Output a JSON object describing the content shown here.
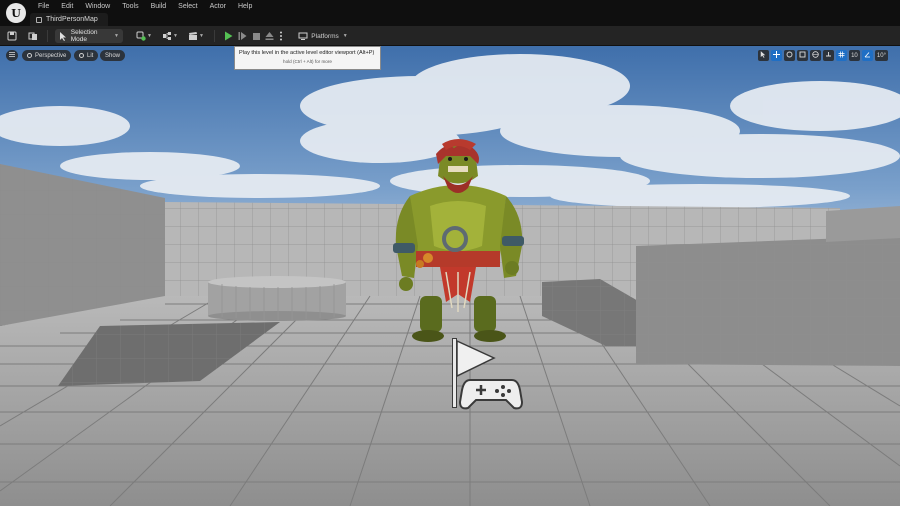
{
  "app": {
    "logo_glyph": "U"
  },
  "menu": [
    "File",
    "Edit",
    "Window",
    "Tools",
    "Build",
    "Select",
    "Actor",
    "Help"
  ],
  "tab": {
    "label": "ThirdPersonMap"
  },
  "toolbar": {
    "selection_mode_label": "Selection Mode",
    "platforms_label": "Platforms"
  },
  "viewport": {
    "perspective_label": "Perspective",
    "lit_label": "Lit",
    "show_label": "Show",
    "grid_snap_value": "10",
    "rotation_snap_value": "10°"
  },
  "tooltip": {
    "text": "Play this level in the active level editor viewport (Alt+P)",
    "hint": "hold (Ctrl + Alt) for more"
  },
  "colors": {
    "sky_top": "#4f7fb8",
    "sky_bottom": "#c3d3e4",
    "floor": "#9e9e9e",
    "wall": "#b7b7b7",
    "accent_blue": "#1f6fc5",
    "play_green": "#54c053"
  },
  "icons": {
    "save": "save-icon",
    "content_browser": "content-browser-icon",
    "add_actor": "add-actor-icon",
    "blueprints": "blueprint-icon",
    "cinematics": "clapper-icon",
    "play": "play-icon",
    "skip": "step-icon",
    "stop": "stop-icon",
    "eject": "eject-icon",
    "platforms": "platforms-icon",
    "player_start": "player-start-icon"
  }
}
